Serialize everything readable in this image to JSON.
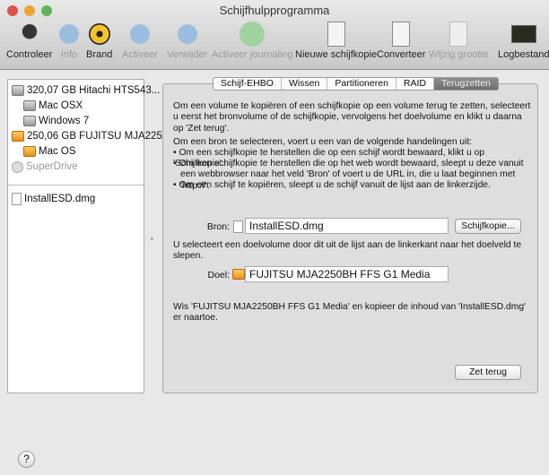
{
  "window": {
    "title": "Schijfhulpprogramma"
  },
  "toolbar": [
    {
      "label": "Controleer",
      "icon": "microscope-icon",
      "enabled": true
    },
    {
      "label": "Info",
      "icon": "info-icon",
      "enabled": false
    },
    {
      "label": "Brand",
      "icon": "burn-icon",
      "enabled": true
    },
    {
      "label": "Activeer",
      "icon": "mount-icon",
      "enabled": false
    },
    {
      "label": "Verwijder",
      "icon": "eject-icon",
      "enabled": false
    },
    {
      "label": "Activeer journaling",
      "icon": "journaling-icon",
      "enabled": false
    },
    {
      "label": "Nieuwe schijfkopie",
      "icon": "new-image-icon",
      "enabled": true
    },
    {
      "label": "Converteer",
      "icon": "convert-icon",
      "enabled": true
    },
    {
      "label": "Wijzig grootte",
      "icon": "resize-icon",
      "enabled": false
    },
    {
      "label": "Logbestand",
      "icon": "log-icon",
      "enabled": true
    }
  ],
  "sidebar": {
    "items": [
      {
        "label": "320,07 GB Hitachi HTS543..."
      },
      {
        "label": "Mac OSX"
      },
      {
        "label": "Windows 7"
      },
      {
        "label": "250,06 GB FUJITSU MJA225..."
      },
      {
        "label": "Mac OS"
      },
      {
        "label": "SuperDrive"
      },
      {
        "label": "InstallESD.dmg"
      }
    ]
  },
  "tabs": [
    "Schijf-EHBO",
    "Wissen",
    "Partitioneren",
    "RAID",
    "Terugzetten"
  ],
  "main": {
    "intro": "Om een volume te kopiëren of een schijfkopie op een volume terug te zetten, selecteert u eerst het bronvolume of de schijfkopie, vervolgens het doelvolume en klikt u daarna op 'Zet terug'.",
    "howto": "Om een bron te selecteren, voert u een van de volgende handelingen uit:",
    "bullets": [
      "• Om een schijfkopie te herstellen die op een schijf wordt bewaard, klikt u op 'Schijfkopie'.",
      "• Om een schijfkopie te herstellen die op het web wordt bewaard, sleept u deze vanuit een webbrowser naar het veld 'Bron' of voert u de URL in, die u laat beginnen met 'http://'.",
      "• Om een schijf te kopiëren, sleept u de schijf vanuit de lijst aan de linkerzijde."
    ],
    "source_label": "Bron:",
    "source_value": "InstallESD.dmg",
    "image_button": "Schijfkopie...",
    "dest_hint": "U selecteert een doelvolume door dit uit de lijst aan de linkerkant naar het doelveld te slepen.",
    "dest_label": "Doel:",
    "dest_value": "FUJITSU MJA2250BH FFS G1 Media",
    "summary": "Wis 'FUJITSU MJA2250BH FFS G1 Media' en kopieer de inhoud van 'InstallESD.dmg' er naartoe.",
    "restore_button": "Zet terug"
  },
  "help": "?"
}
